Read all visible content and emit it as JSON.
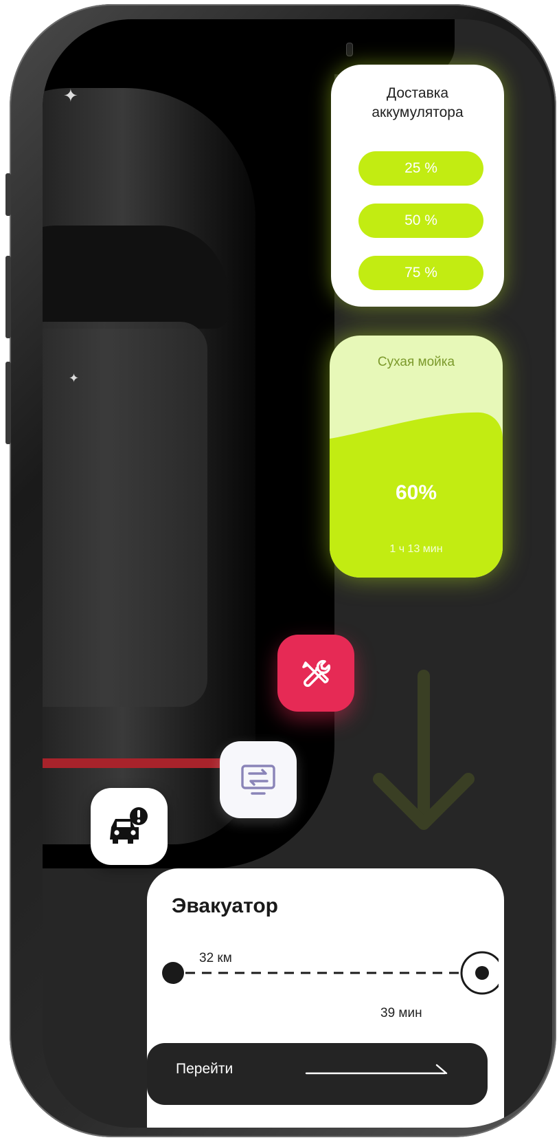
{
  "battery_card": {
    "title_line1": "Доставка",
    "title_line2": "аккумулятора",
    "options": [
      "25 %",
      "50 %",
      "75 %"
    ]
  },
  "wash_card": {
    "title": "Сухая мойка",
    "percent": "60%",
    "progress": 0.6,
    "time": "1 ч 13 мин"
  },
  "quick_actions": [
    {
      "icon": "wrench-screwdriver-icon",
      "color": "#e62a55"
    },
    {
      "icon": "monitor-transfer-icon",
      "color": "#f7f7fb"
    },
    {
      "icon": "car-alert-icon",
      "color": "#ffffff"
    }
  ],
  "tow_card": {
    "title": "Эвакуатор",
    "distance": "32 км",
    "duration": "39 мин",
    "action_label": "Перейти"
  },
  "colors": {
    "accent": "#c2ec12",
    "accent_light": "#e7f8b8",
    "danger": "#e62a55",
    "background": "#262626"
  }
}
